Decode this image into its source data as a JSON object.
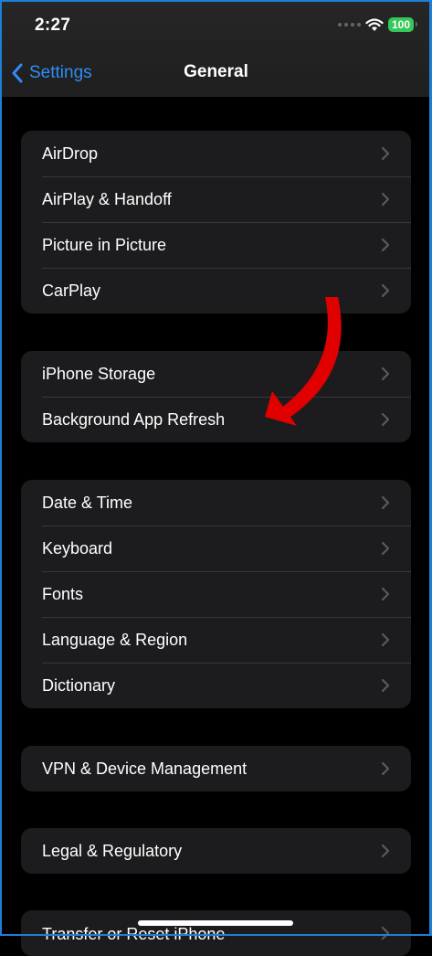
{
  "status_bar": {
    "time": "2:27",
    "battery": "100"
  },
  "nav": {
    "back_label": "Settings",
    "title": "General"
  },
  "groups": [
    {
      "items": [
        {
          "label": "AirDrop"
        },
        {
          "label": "AirPlay & Handoff"
        },
        {
          "label": "Picture in Picture"
        },
        {
          "label": "CarPlay"
        }
      ]
    },
    {
      "items": [
        {
          "label": "iPhone Storage"
        },
        {
          "label": "Background App Refresh"
        }
      ]
    },
    {
      "items": [
        {
          "label": "Date & Time"
        },
        {
          "label": "Keyboard"
        },
        {
          "label": "Fonts"
        },
        {
          "label": "Language & Region"
        },
        {
          "label": "Dictionary"
        }
      ]
    },
    {
      "items": [
        {
          "label": "VPN & Device Management"
        }
      ]
    },
    {
      "items": [
        {
          "label": "Legal & Regulatory"
        }
      ]
    },
    {
      "items": [
        {
          "label": "Transfer or Reset iPhone"
        }
      ]
    }
  ],
  "colors": {
    "accent": "#2f8cf6",
    "annotation_arrow": "#e00000",
    "battery": "#34c759"
  }
}
